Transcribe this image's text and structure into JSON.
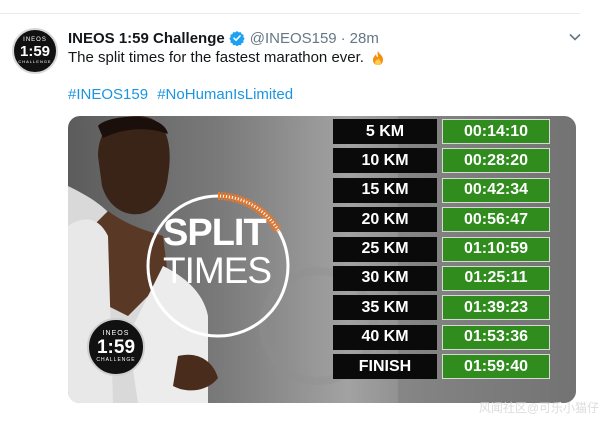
{
  "tweet": {
    "account_name": "INEOS 1:59 Challenge",
    "handle": "@INEOS159",
    "separator": "·",
    "time": "28m",
    "text": "The split times for the fastest marathon ever.",
    "hashtags": [
      "#INEOS159",
      "#NoHumanIsLimited"
    ]
  },
  "logo": {
    "top": "INEOS",
    "mid": "1:59",
    "bottom": "CHALLENGE"
  },
  "media": {
    "split_title_line1": "SPLIT",
    "split_title_line2": "TIMES",
    "splits": [
      {
        "distance": "5 KM",
        "time": "00:14:10"
      },
      {
        "distance": "10 KM",
        "time": "00:28:20"
      },
      {
        "distance": "15 KM",
        "time": "00:42:34"
      },
      {
        "distance": "20 KM",
        "time": "00:56:47"
      },
      {
        "distance": "25 KM",
        "time": "01:10:59"
      },
      {
        "distance": "30 KM",
        "time": "01:25:11"
      },
      {
        "distance": "35 KM",
        "time": "01:39:23"
      },
      {
        "distance": "40 KM",
        "time": "01:53:36"
      },
      {
        "distance": "FINISH",
        "time": "01:59:40"
      }
    ]
  },
  "watermark": "风闻社区@可乐小猫仔",
  "colors": {
    "hashtag": "#1b95e0",
    "verified": "#1da1f2",
    "split_green": "#2f8c1d",
    "distance_black": "#0a0a0a",
    "progress_orange": "#e8782b"
  },
  "icons": {
    "verified": "verified-badge-icon",
    "caret": "chevron-down-icon",
    "emoji": "fire-emoji-icon"
  }
}
